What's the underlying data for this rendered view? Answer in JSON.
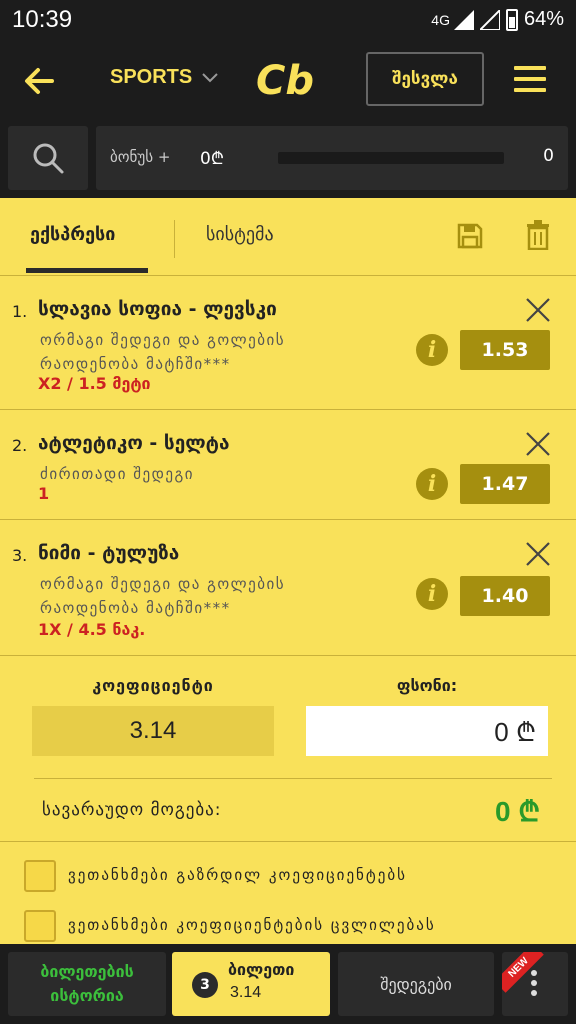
{
  "status_bar": {
    "time": "10:39",
    "network": "4G",
    "battery": "64%"
  },
  "app_bar": {
    "sports_label": "SPORTS",
    "logo_text": "Cb",
    "login_label": "შესვლა"
  },
  "bonus": {
    "label": "ბონუს +",
    "amount": "0₾",
    "count": "0",
    "progress": 0
  },
  "tabs": {
    "express": "ექსპრესი",
    "system": "სისტემა"
  },
  "bets": [
    {
      "index": "1.",
      "teams": "სლავია სოფია - ლევსკი",
      "market": "ორმაგი შედეგი და გოლების რაოდენობა მატჩში***",
      "pick": "X2 / 1.5 მეტი",
      "odds": "1.53"
    },
    {
      "index": "2.",
      "teams": "ატლეტიკო - სელტა",
      "market": "ძირითადი შედეგი",
      "pick": "1",
      "odds": "1.47"
    },
    {
      "index": "3.",
      "teams": "ნიმი - ტულუზა",
      "market": "ორმაგი შედეგი და გოლების რაოდენობა მატჩში***",
      "pick": "1X / 4.5 ნაკ.",
      "odds": "1.40"
    }
  ],
  "summary": {
    "coef_label": "კოეფიციენტი",
    "coef_value": "3.14",
    "stake_label": "ფსონი:",
    "stake_value": "0 ₾",
    "win_label": "სავარაუდო მოგება:",
    "win_value": "0 ₾"
  },
  "options": {
    "accept_increase": "ვეთანხმები გაზრდილ კოეფიციენტებს",
    "accept_changes": "ვეთანხმები კოეფიციენტების ცვლილებას"
  },
  "bottom_bar": {
    "history_line1": "ბილეთების",
    "history_line2": "ისტორია",
    "slip_count": "3",
    "slip_label": "ბილეთი",
    "slip_value": "3.14",
    "events_label": "შედეგები",
    "new_badge": "NEW"
  },
  "colors": {
    "accent": "#f9e15a",
    "dark": "#1c1c1c",
    "odds_bg": "#a58f0f",
    "win_green": "#2a9a2a",
    "pick_red": "#cc2222"
  }
}
